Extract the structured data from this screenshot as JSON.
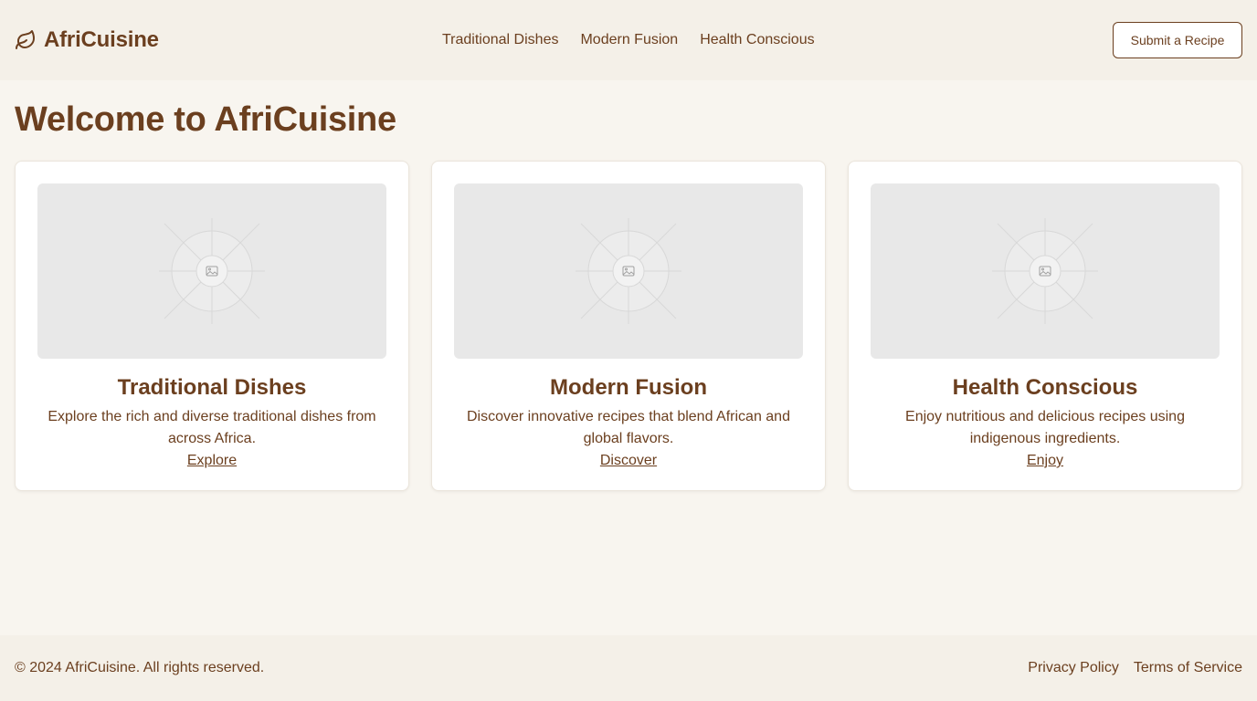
{
  "header": {
    "brand": "AfriCuisine",
    "brand_icon": "leaf-icon",
    "nav": [
      "Traditional Dishes",
      "Modern Fusion",
      "Health Conscious"
    ],
    "submit_label": "Submit a Recipe"
  },
  "main": {
    "title": "Welcome to AfriCuisine",
    "cards": [
      {
        "title": "Traditional Dishes",
        "description": "Explore the rich and diverse traditional dishes from across Africa.",
        "link": "Explore",
        "image_icon": "image-placeholder-icon"
      },
      {
        "title": "Modern Fusion",
        "description": "Discover innovative recipes that blend African and global flavors.",
        "link": "Discover",
        "image_icon": "image-placeholder-icon"
      },
      {
        "title": "Health Conscious",
        "description": "Enjoy nutritious and delicious recipes using indigenous ingredients.",
        "link": "Enjoy",
        "image_icon": "image-placeholder-icon"
      }
    ]
  },
  "footer": {
    "copyright": "© 2024 AfriCuisine. All rights reserved.",
    "links": [
      "Privacy Policy",
      "Terms of Service"
    ]
  },
  "colors": {
    "accent": "#6b3f1f",
    "page_background": "#f8f5ef",
    "header_background": "#f4f0e8",
    "card_background": "#ffffff",
    "placeholder": "#e8e8e8"
  }
}
